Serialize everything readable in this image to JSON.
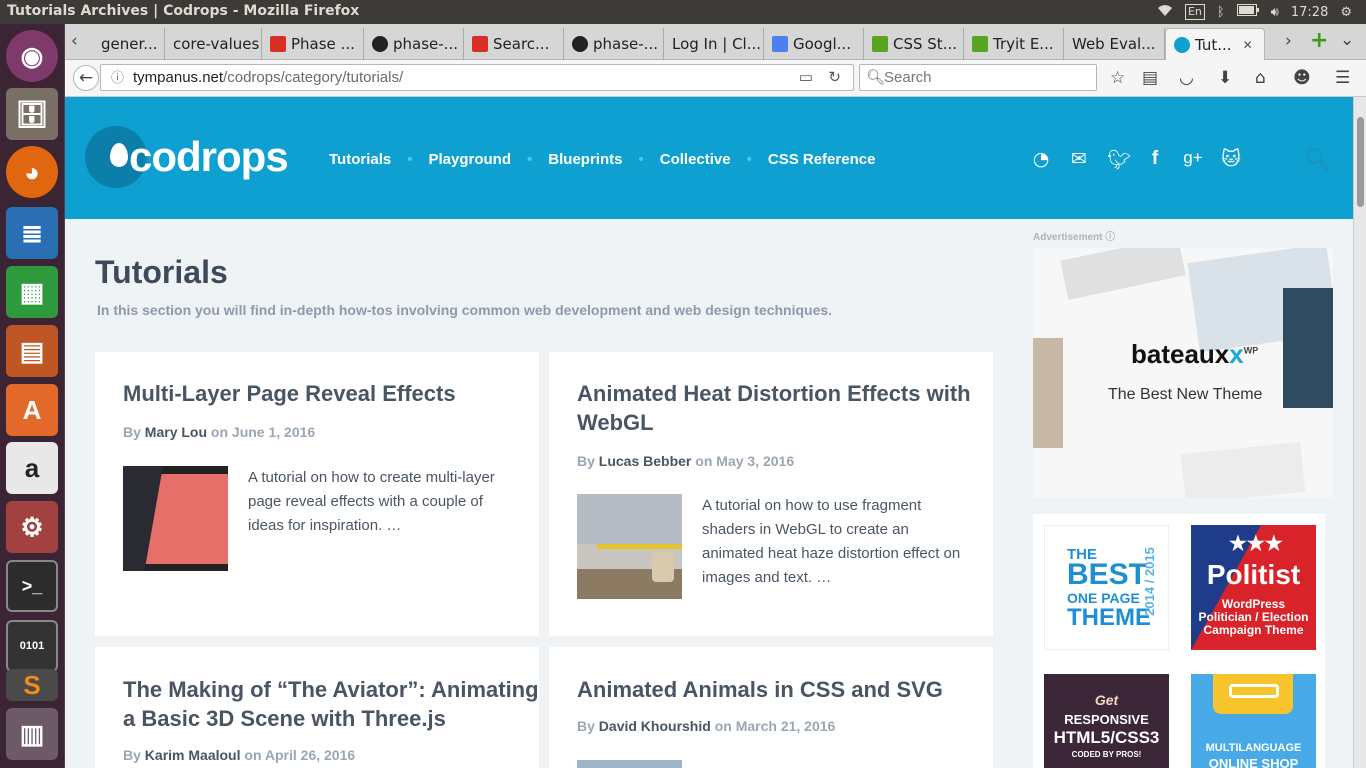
{
  "window": {
    "title": "Tutorials Archives | Codrops - Mozilla Firefox",
    "tray": {
      "lang": "En",
      "time": "17:28"
    }
  },
  "tabs": [
    {
      "label": "gener...",
      "icon": "page-icon"
    },
    {
      "label": "core-values",
      "icon": "page-icon"
    },
    {
      "label": "Phase ...",
      "icon": "gmail-icon"
    },
    {
      "label": "phase-...",
      "icon": "github-icon"
    },
    {
      "label": "Searc...",
      "icon": "gmail-icon"
    },
    {
      "label": "phase-...",
      "icon": "github-icon"
    },
    {
      "label": "Log In | Cl...",
      "icon": "page-icon"
    },
    {
      "label": "Googl...",
      "icon": "google-translate-icon"
    },
    {
      "label": "CSS St...",
      "icon": "codepen-icon"
    },
    {
      "label": "Tryit E...",
      "icon": "w3-icon"
    },
    {
      "label": "Web Eval...",
      "icon": "page-icon"
    },
    {
      "label": "Tut...",
      "icon": "codrops-icon",
      "active": true
    }
  ],
  "navbar": {
    "url_host": "tympanus.net",
    "url_path": "/codrops/category/tutorials/",
    "search_placeholder": "Search"
  },
  "site": {
    "logo_text": "codrops",
    "nav": [
      "Tutorials",
      "Playground",
      "Blueprints",
      "Collective",
      "CSS Reference"
    ],
    "social": [
      "rss-icon",
      "mail-icon",
      "twitter-icon",
      "facebook-icon",
      "google-plus-icon",
      "github-icon"
    ]
  },
  "page": {
    "title": "Tutorials",
    "description": "In this section you will find in-depth how-tos involving common web development and web design techniques."
  },
  "articles": [
    {
      "title_line1": "Multi-Layer Page Reveal Effects",
      "title_line2": "",
      "by": "By",
      "author": "Mary Lou",
      "on": "on",
      "date": "June 1, 2016",
      "excerpt": "A tutorial on how to create multi-layer page reveal effects with a couple of ideas for inspiration. …"
    },
    {
      "title_line1": "Animated Heat Distortion Effects with",
      "title_line2": "WebGL",
      "by": "By",
      "author": "Lucas Bebber",
      "on": "on",
      "date": "May 3, 2016",
      "excerpt": "A tutorial on how to use fragment shaders in WebGL to create an animated heat haze distortion effect on images and text. …"
    },
    {
      "title_line1": "The Making of “The Aviator”: Animating",
      "title_line2": "a Basic 3D Scene with Three.js",
      "by": "By",
      "author": "Karim Maaloul",
      "on": "on",
      "date": "April 26, 2016",
      "excerpt": ""
    },
    {
      "title_line1": "Animated Animals in CSS and SVG",
      "title_line2": "",
      "by": "By",
      "author": "David Khourshid",
      "on": "on",
      "date": "March 21, 2016",
      "excerpt": ""
    }
  ],
  "sidebar": {
    "ad_label": "Advertisement",
    "ad": {
      "brand": "bateaux",
      "brand_x": "x",
      "brand_sup": "WP",
      "tagline": "The Best New Theme"
    },
    "promos": [
      {
        "l1": "THE",
        "l2": "BEST",
        "l3": "ONE PAGE",
        "l4": "THEME",
        "years": "2014 / 2015"
      },
      {
        "l1": "Politist",
        "l2": "WordPress",
        "l3": "Politician / Election",
        "l4": "Campaign Theme"
      },
      {
        "l1": "Get",
        "l2": "RESPONSIVE",
        "l3": "HTML5/CSS3",
        "l4": "CODED BY PROS!"
      },
      {
        "l1": "MULTILANGUAGE",
        "l2": "ONLINE SHOP"
      }
    ]
  },
  "launcher": [
    "ubuntu-dash-icon",
    "files-icon",
    "firefox-icon",
    "writer-icon",
    "calc-icon",
    "impress-icon",
    "software-center-icon",
    "amazon-icon",
    "system-settings-icon",
    "terminal-icon",
    "binary-editor-icon",
    "sublime-icon",
    "workspaces-icon"
  ]
}
